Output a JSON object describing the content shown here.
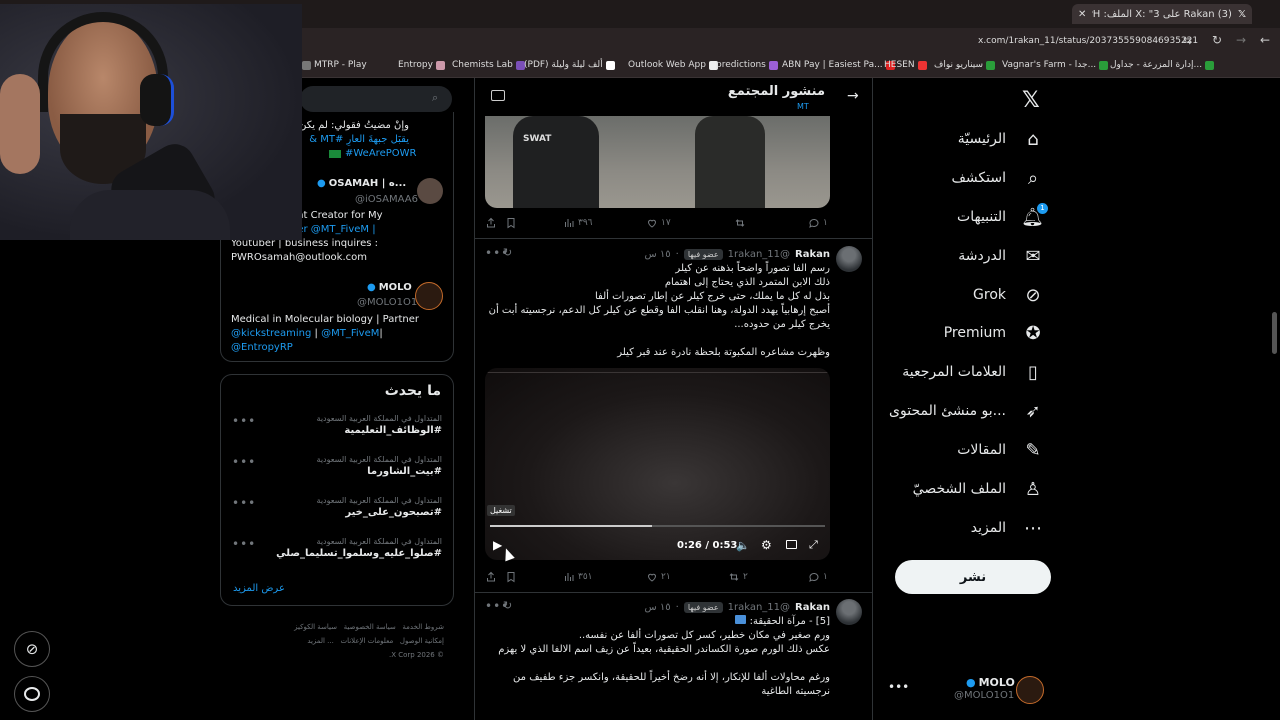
{
  "browser": {
    "tab_title": "(3) Rakan على X: \"3 الملف: ALPH",
    "url": "x.com/1rakan_11/status/2037355590846935221",
    "bookmarks": [
      "MTRP - Play",
      "Entropy",
      "Chemists Lab",
      "(PDF) ألف ليلة وليلة",
      "Outlook Web App",
      "predictions",
      "ABN Pay | Easiest Pa...",
      "HESEN",
      "سيناريو نواف",
      "Vagnar's Farm - جدا...",
      "إدارة المزرعة - جداول..."
    ]
  },
  "nav": {
    "items": [
      {
        "label": "الرئيسيّة",
        "icon": "home-icon"
      },
      {
        "label": "استكشف",
        "icon": "search-icon"
      },
      {
        "label": "التنبيهات",
        "icon": "bell-icon",
        "badge": "1"
      },
      {
        "label": "الدردشة",
        "icon": "mail-icon"
      },
      {
        "label": "Grok",
        "icon": "grok-icon"
      },
      {
        "label": "Premium",
        "icon": "premium-icon"
      },
      {
        "label": "العلامات المرجعية",
        "icon": "bookmark-icon"
      },
      {
        "label": "...بو منشئ المحتوى",
        "icon": "rocket-icon"
      },
      {
        "label": "المقالات",
        "icon": "article-icon"
      },
      {
        "label": "الملف الشخصيّ",
        "icon": "profile-icon"
      },
      {
        "label": "المزيد",
        "icon": "more-icon"
      }
    ],
    "post_button": "نشر",
    "account": {
      "name": "MOLO",
      "handle": "@MOLO1O1"
    }
  },
  "main": {
    "header_title": "منشور المجتمع",
    "header_sub": "MT",
    "swat_text": "SWAT",
    "tweet1_actions": {
      "views": "٣٩٦",
      "likes": "١٧",
      "replies": "١"
    },
    "tweet2": {
      "name": "Rakan",
      "handle": "@1rakan_11",
      "badge": "عضو فيها",
      "time": "١٥ س",
      "lines": [
        "رسم الفا تصوراً واضحاً بذهنه عن كيلر",
        "ذلك الابن المتمرد الذي يحتاج إلى اهتمام",
        "بذل له كل ما يملك، حتى خرج كيلر عن إطار تصورات ألفا",
        "أصبح إرهابياً يهدد الدولة، وهنا انقلب الفا وقطع عن كيلر كل الدعم، نرجسيته أبت أن",
        "يخرج كيلر من حدوده...",
        "",
        "وظهرت مشاعره المكبوتة بلحظة نادرة عند قبر كيلر"
      ],
      "video_time": "0:26 / 0:53",
      "play_tooltip": "تشغيل",
      "actions": {
        "views": "٣٥١",
        "likes": "٢١",
        "retweets": "٢",
        "replies": "١"
      }
    },
    "tweet3": {
      "name": "Rakan",
      "handle": "@1rakan_11",
      "badge": "عضو فيها",
      "time": "١٥ س",
      "lines": [
        "[5] - مرآة الحقيقة:",
        "ورم صغير في مكان خطير، كسر كل تصورات ألفا عن نفسه..",
        "عكس ذلك الورم صورة الكساندر الحقيقية، بعيداً عن زيف اسم الالفا الذي لا يهزم",
        "",
        "ورغم محاولات ألفا للإنكار، إلا أنه رضخ أخيراً للحقيقة، وانكسر جزء طفيف من",
        "نرجسيته الطاغية"
      ]
    }
  },
  "sidebar": {
    "members_text_1": "وإنْ مضيتُ فقولي: لم يكن",
    "members_text_2": "يقبَل جبهةَ العارِ #MT & ",
    "members_tag": "#WeArePOWR",
    "member1": {
      "name": "OSAMAH | ه...",
      "handle": "@iOSAMAA6",
      "bio1": "ent Creator for My",
      "bio2": "der @MT_FiveM |",
      "bio3": "Youtuber | business inquires :",
      "bio4": "PWROsamah@outlook.com"
    },
    "member2": {
      "name": "MOLO",
      "handle": "@MOLO1O1",
      "bio1": "Medical in Molecular biology | Partner",
      "bio2a": "@kickstreaming",
      "bio2b": "@MT_FiveM",
      "bio3": "@EntropyRP"
    },
    "whats_happening_title": "ما يحدث",
    "trends": [
      {
        "cat": "المتداول في المملكة العربية السعودية",
        "tag": "#الوظائف_التعليمية"
      },
      {
        "cat": "المتداول في المملكة العربية السعودية",
        "tag": "#بيت_الشاورما"
      },
      {
        "cat": "المتداول في المملكة العربية السعودية",
        "tag": "#تصبحون_على_خير"
      },
      {
        "cat": "المتداول في المملكة العربية السعودية",
        "tag": "#صلوا_عليه_وسلموا_تسليما_صلي"
      }
    ],
    "show_more": "عرض المزيد",
    "footer": [
      "شروط الخدمة",
      "سياسة الخصوصية",
      "سياسة الكوكيز",
      "إمكانية الوصول",
      "معلومات الإعلانات",
      "... المزيد",
      "© 2026 X Corp."
    ]
  }
}
